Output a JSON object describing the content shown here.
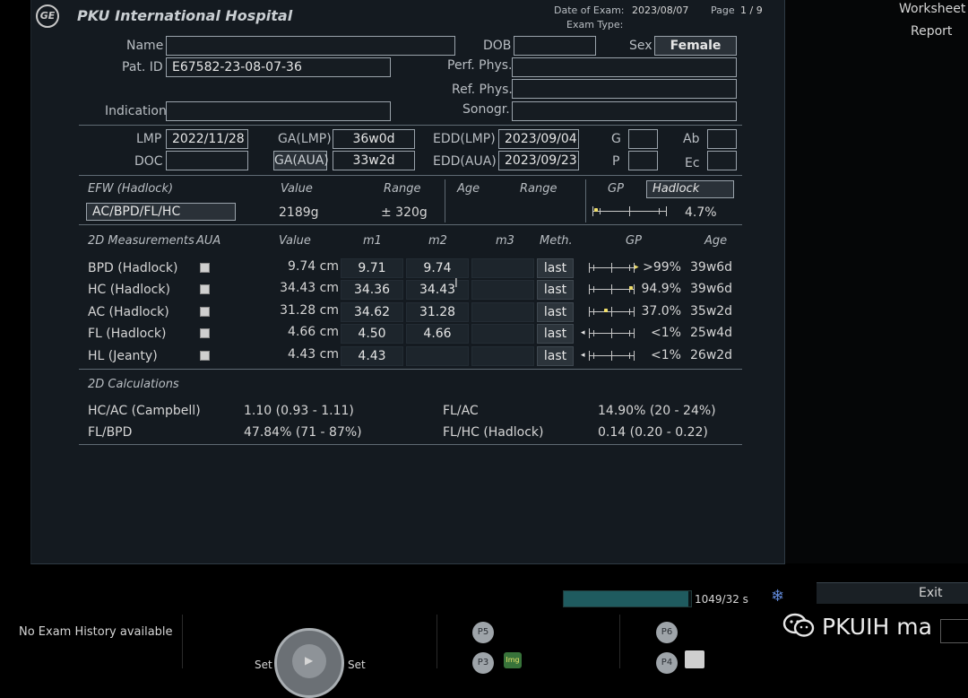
{
  "header": {
    "hospital": "PKU International Hospital",
    "date_label": "Date of Exam:",
    "date_value": "2023/08/07",
    "page_label": "Page",
    "page_value": "1 / 9",
    "exam_type_label": "Exam Type:"
  },
  "right_menu": {
    "worksheet": "Worksheet",
    "report": "Report",
    "exit": "Exit"
  },
  "patient": {
    "name_label": "Name",
    "name": "",
    "dob_label": "DOB",
    "dob": "",
    "sex_label": "Sex",
    "sex": "Female",
    "patid_label": "Pat. ID",
    "patid": "E67582-23-08-07-36",
    "perf_label": "Perf. Phys.",
    "perf": "",
    "ref_label": "Ref. Phys.",
    "ref": "",
    "indication_label": "Indication",
    "indication": "",
    "sonogr_label": "Sonogr.",
    "sonogr": ""
  },
  "dates": {
    "lmp_label": "LMP",
    "lmp": "2022/11/28",
    "doc_label": "DOC",
    "doc": "",
    "galmp_label": "GA(LMP)",
    "galmp": "36w0d",
    "gaaua_label": "GA(AUA)",
    "gaaua": "33w2d",
    "eddlmp_label": "EDD(LMP)",
    "eddlmp": "2023/09/04",
    "eddaua_label": "EDD(AUA)",
    "eddaua": "2023/09/23",
    "g_label": "G",
    "p_label": "P",
    "ab_label": "Ab",
    "ec_label": "Ec"
  },
  "efw": {
    "title": "EFW (Hadlock)",
    "value_label": "Value",
    "range_label": "Range",
    "age_label": "Age",
    "age_range_label": "Range",
    "gp_label": "GP",
    "gp_method": "Hadlock",
    "formula": "AC/BPD/FL/HC",
    "value": "2189g",
    "range": "± 320g",
    "gp": "4.7%",
    "gp_fraction": 0.047
  },
  "measurements": {
    "title": "2D Measurements",
    "cols": {
      "aua": "AUA",
      "value": "Value",
      "m1": "m1",
      "m2": "m2",
      "m3": "m3",
      "meth": "Meth.",
      "gp": "GP",
      "age": "Age"
    },
    "rows": [
      {
        "name": "BPD (Hadlock)",
        "value": "9.74 cm",
        "m1": "9.71",
        "m2": "9.74",
        "m3": "",
        "meth": "last",
        "gp": ">99%",
        "age": "39w6d",
        "gp_fraction": 1.0,
        "over": true
      },
      {
        "name": "HC (Hadlock)",
        "value": "34.43 cm",
        "m1": "34.36",
        "m2": "34.43",
        "m3": "",
        "meth": "last",
        "gp": "94.9%",
        "age": "39w6d",
        "gp_fraction": 0.949,
        "over": false
      },
      {
        "name": "AC (Hadlock)",
        "value": "31.28 cm",
        "m1": "34.62",
        "m2": "31.28",
        "m3": "",
        "meth": "last",
        "gp": "37.0%",
        "age": "35w2d",
        "gp_fraction": 0.37,
        "over": false
      },
      {
        "name": "FL (Hadlock)",
        "value": "4.66 cm",
        "m1": "4.50",
        "m2": "4.66",
        "m3": "",
        "meth": "last",
        "gp": "<1%",
        "age": "25w4d",
        "gp_fraction": 0.0,
        "over": false
      },
      {
        "name": "HL (Jeanty)",
        "value": "4.43 cm",
        "m1": "4.43",
        "m2": "",
        "m3": "",
        "meth": "last",
        "gp": "<1%",
        "age": "26w2d",
        "gp_fraction": 0.0,
        "over": false
      }
    ]
  },
  "calculations": {
    "title": "2D Calculations",
    "items": [
      {
        "label": "HC/AC (Campbell)",
        "value": "1.10 (0.93 - 1.11)"
      },
      {
        "label": "FL/BPD",
        "value": "47.84% (71 - 87%)"
      },
      {
        "label": "FL/AC",
        "value": "14.90% (20 - 24%)"
      },
      {
        "label": "FL/HC (Hadlock)",
        "value": "0.14 (0.20 - 0.22)"
      }
    ]
  },
  "bottom": {
    "progress_text": "1049/32 s",
    "progress_fraction": 0.98,
    "history": "No Exam History available",
    "set_left": "Set",
    "set_right": "Set",
    "p5": "P5",
    "p3": "P3",
    "p6": "P6",
    "p4": "P4",
    "img": "Img",
    "watermark": "PKUIH ma"
  }
}
